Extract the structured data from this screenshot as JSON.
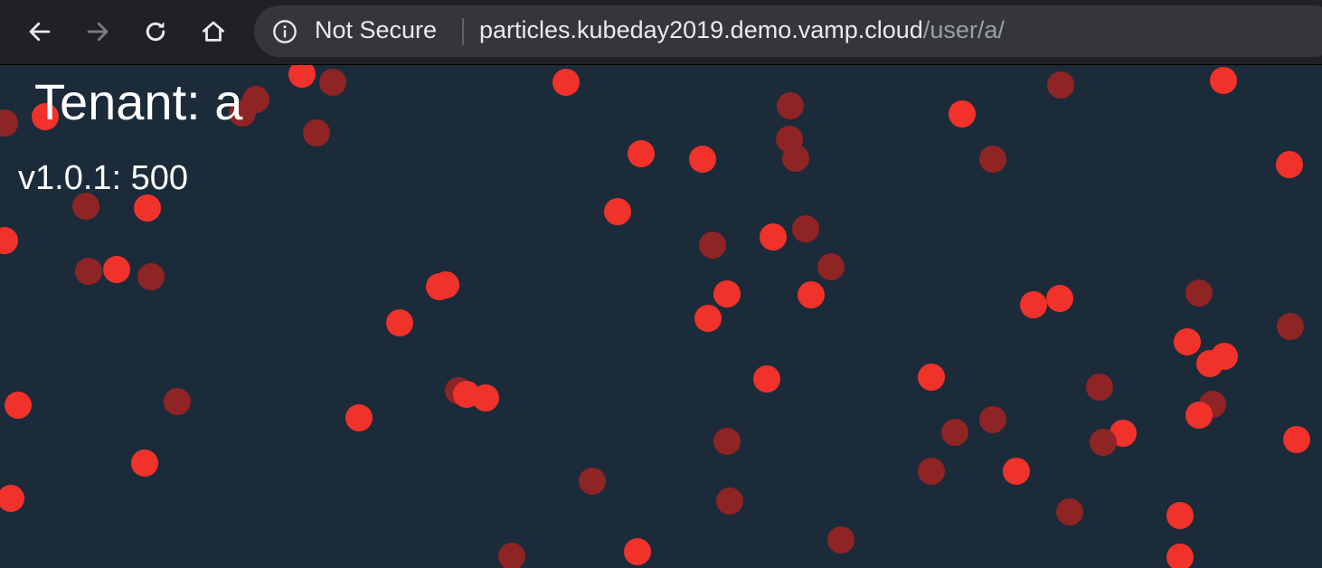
{
  "browser": {
    "security_label": "Not Secure",
    "url_host": "particles.kubeday2019.demo.vamp.cloud",
    "url_path": "/user/a/"
  },
  "page": {
    "tenant_label": "Tenant: a",
    "version_label": "v1.0.1: 500"
  },
  "colors": {
    "background": "#1c2b3a",
    "particle_bright": "#f0322a",
    "particle_dim": "#8e2424"
  }
}
